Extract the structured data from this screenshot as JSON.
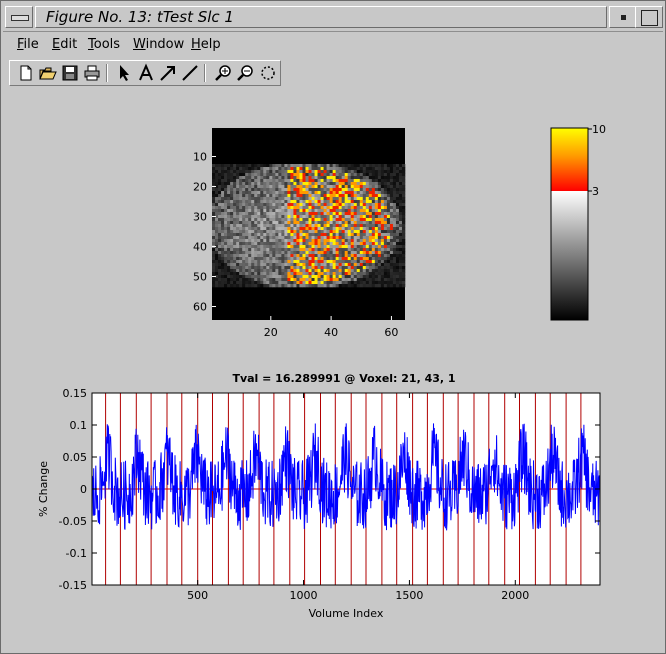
{
  "window": {
    "title": "Figure No. 13: tTest Slc 1",
    "icons": {
      "menu": "window-menu-icon",
      "minimize": "minimize-icon",
      "maximize": "maximize-icon"
    }
  },
  "menu": [
    {
      "label": "File",
      "mnemonic": "F"
    },
    {
      "label": "Edit",
      "mnemonic": "E"
    },
    {
      "label": "Tools",
      "mnemonic": "T"
    },
    {
      "label": "Window",
      "mnemonic": "W"
    },
    {
      "label": "Help",
      "mnemonic": "H"
    }
  ],
  "toolbar": [
    "new-figure-icon",
    "open-file-icon",
    "save-icon",
    "print-icon",
    "select-arrow-icon",
    "insert-text-icon",
    "insert-arrow-icon",
    "insert-line-icon",
    "zoom-in-icon",
    "zoom-out-icon",
    "rotate-3d-icon"
  ],
  "brain_image": {
    "yticks": [
      10,
      20,
      30,
      40,
      50,
      60
    ],
    "xticks": [
      20,
      40,
      60
    ],
    "x_range": [
      1,
      64
    ],
    "y_range": [
      1,
      64
    ]
  },
  "colorbar": {
    "max_label": "10",
    "threshold_label": "3",
    "colors": {
      "top": "#ffff00",
      "mid": "#ff8800",
      "threshold": "#ff0000",
      "gray_top": "#ffffff",
      "gray_bottom": "#000000"
    }
  },
  "chart_data": {
    "type": "line",
    "title": "Tval = 16.289991 @ Voxel: 21, 43, 1",
    "xlabel": "Volume Index",
    "ylabel": "% Change",
    "xlim": [
      1,
      2400
    ],
    "ylim": [
      -0.15,
      0.15
    ],
    "xticks": [
      500,
      1000,
      1500,
      2000
    ],
    "yticks": [
      0.15,
      0.1,
      0.05,
      0,
      -0.05,
      -0.1,
      -0.15
    ],
    "ytick_labels": [
      "0.15",
      "0.1",
      "0.05",
      "0",
      "-0.05",
      "-0.1",
      "-0.15"
    ],
    "series": [
      {
        "color": "#0000ff",
        "values": []
      },
      {
        "color": "#cc0000",
        "values": []
      }
    ],
    "event_lines_x": [
      65,
      135,
      210,
      280,
      355,
      425,
      500,
      570,
      645,
      715,
      790,
      860,
      935,
      1005,
      1080,
      1150,
      1225,
      1295,
      1370,
      1440,
      1515,
      1585,
      1660,
      1730,
      1805,
      1875,
      1950,
      2020,
      2095,
      2165,
      2240,
      2310
    ],
    "grid": false
  }
}
